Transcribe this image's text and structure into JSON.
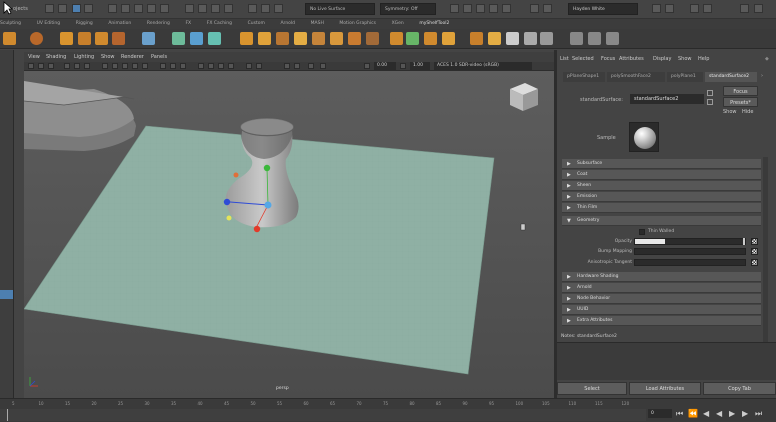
{
  "status_line": {
    "menu_text": "ojects",
    "no_live_surface": "No Live Surface",
    "symmetry": "Symmetry: Off",
    "user": "Hayden White"
  },
  "shelf_tabs": [
    "Sculpting",
    "UV Editing",
    "Rigging",
    "Animation",
    "Rendering",
    "FX",
    "FX Caching",
    "Custom",
    "Arnold",
    "MASH",
    "Motion Graphics",
    "XGen",
    "myShelfTool2"
  ],
  "viewport": {
    "menus": [
      "View",
      "Shading",
      "Lighting",
      "Show",
      "Renderer",
      "Panels"
    ],
    "field_a": "0.00",
    "field_b": "1.00",
    "color_space": "ACES 1.0 SDR-video (sRGB)",
    "camera_label": "persp"
  },
  "attribute_editor": {
    "menus": [
      "List",
      "Selected",
      "Focus",
      "Attributes",
      "Display",
      "Show",
      "Help"
    ],
    "tabs": [
      "pPlaneShape1",
      "polySmoothFace2",
      "polyPlane1",
      "standardSurface2"
    ],
    "node_type_label": "standardSurface:",
    "node_name": "standardSurface2",
    "focus_button": "Focus",
    "presets_button": "Presets*",
    "show_button": "Show",
    "hide_button": "Hide",
    "sample_label": "Sample",
    "sections": [
      {
        "label": "Subsurface",
        "expanded": false
      },
      {
        "label": "Coat",
        "expanded": false
      },
      {
        "label": "Sheen",
        "expanded": false
      },
      {
        "label": "Emission",
        "expanded": false
      },
      {
        "label": "Thin Film",
        "expanded": false
      },
      {
        "label": "Geometry",
        "expanded": true
      }
    ],
    "geometry": {
      "thin_walled_label": "Thin Walled",
      "opacity_label": "Opacity",
      "bump_label": "Bump Mapping",
      "aniso_label": "Anisotropic Tangent"
    },
    "sections_after": [
      {
        "label": "Hardware Shading"
      },
      {
        "label": "Arnold"
      },
      {
        "label": "Node Behavior"
      },
      {
        "label": "UUID"
      },
      {
        "label": "Extra Attributes"
      }
    ],
    "notes_label": "Notes: standardSurface2",
    "select_button": "Select",
    "load_attributes_button": "Load Attributes",
    "copy_tab_button": "Copy Tab"
  },
  "timeline": {
    "ticks": [
      "5",
      "10",
      "15",
      "20",
      "25",
      "30",
      "35",
      "40",
      "45",
      "50",
      "55",
      "60",
      "65",
      "70",
      "75",
      "80",
      "85",
      "90",
      "95",
      "100",
      "105",
      "110",
      "115",
      "120"
    ],
    "current_frame": "0"
  },
  "colors": {
    "plane": "#8fb0a4",
    "grid": "#83a89b",
    "manipulator_x": "#e23a2a",
    "manipulator_y": "#3bb83b",
    "manipulator_z": "#2e4bd6",
    "center": "#54a8e6",
    "active_tab": "#555555",
    "selection_blue": "#4d7fb0"
  }
}
